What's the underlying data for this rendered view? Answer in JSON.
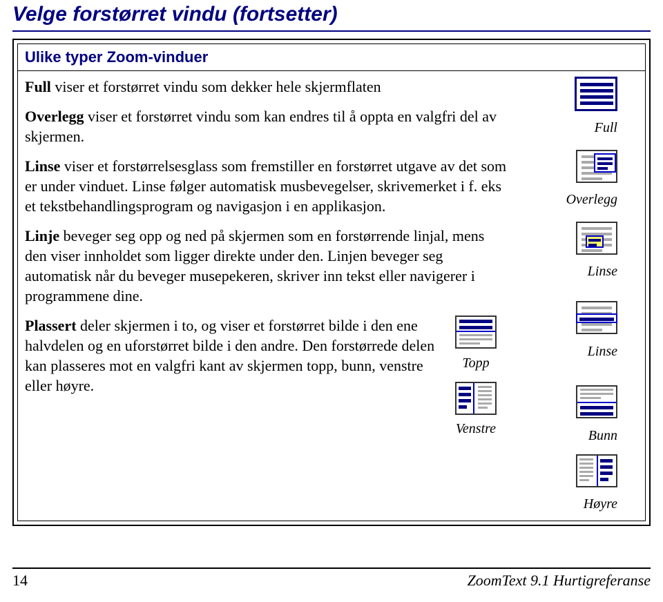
{
  "title": "Velge forstørret vindu (fortsetter)",
  "section_heading": "Ulike typer Zoom-vinduer",
  "paragraphs": {
    "full": {
      "lead": "Full",
      "text": " viser et forstørret vindu som dekker hele skjermflaten"
    },
    "overlegg": {
      "lead": "Overlegg",
      "text": " viser et forstørret vindu som kan endres til å oppta en valgfri del av skjermen."
    },
    "linse": {
      "lead": "Linse",
      "text": " viser et forstørrelsesglass som fremstiller en forstørret utgave av det som er under vinduet. Linse følger automatisk musbevegelser, skrivemerket i f. eks et tekstbehandlingsprogram og navigasjon i en applikasjon."
    },
    "linje": {
      "lead": "Linje",
      "text": " beveger seg opp og ned på skjermen som en forstørrende linjal, mens den viser innholdet som ligger direkte under den. Linjen beveger seg automatisk når du beveger musepekeren, skriver inn tekst eller navigerer i programmene dine."
    },
    "plassert": {
      "lead": "Plassert",
      "text": " deler skjermen i to, og viser et forstørret bilde i den ene halvdelen og en uforstørret bilde i den andre. Den forstørrede delen kan plasseres mot en valgfri kant av skjermen topp, bunn, venstre eller høyre."
    }
  },
  "icon_captions": {
    "full": "Full",
    "overlegg": "Overlegg",
    "linse1": "Linse",
    "linse2": "Linse",
    "topp": "Topp",
    "bunn": "Bunn",
    "venstre": "Venstre",
    "hoyre": "Høyre"
  },
  "footer": {
    "page": "14",
    "doc": "ZoomText 9.1 Hurtigreferanse"
  }
}
